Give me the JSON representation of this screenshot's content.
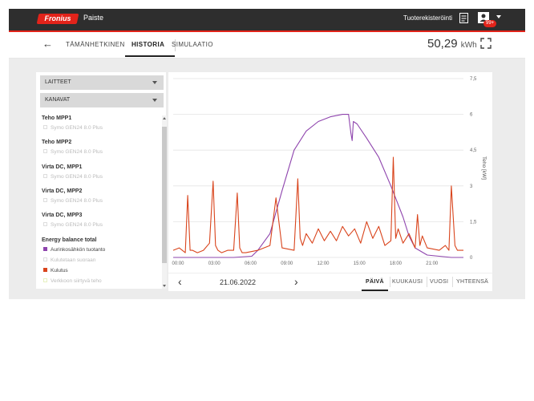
{
  "app": {
    "logo_text": "Fronius",
    "title": "Paiste"
  },
  "header": {
    "register_label": "Tuoterekisteröinti",
    "notification_badge": "99+"
  },
  "nav": {
    "back_icon": "arrow-left-icon",
    "tabs": [
      {
        "label": "TÄMÄNHETKINEN",
        "active": false
      },
      {
        "label": "HISTORIA",
        "active": true
      },
      {
        "label": "SIMULAATIO",
        "active": false
      }
    ],
    "energy_value": "50,29",
    "energy_unit": "kWh"
  },
  "sidebar": {
    "dropdowns": [
      {
        "label": "LAITTEET"
      },
      {
        "label": "KANAVAT"
      }
    ],
    "groups": [
      {
        "title": "Teho MPP1",
        "items": [
          {
            "label": "Symo GEN24 8.0 Plus",
            "color": "#dddddd",
            "active": false
          }
        ]
      },
      {
        "title": "Teho MPP2",
        "items": [
          {
            "label": "Symo GEN24 8.0 Plus",
            "color": "#dddddd",
            "active": false
          }
        ]
      },
      {
        "title": "Virta DC, MPP1",
        "items": [
          {
            "label": "Symo GEN24 8.0 Plus",
            "color": "#dddddd",
            "active": false
          }
        ]
      },
      {
        "title": "Virta DC, MPP2",
        "items": [
          {
            "label": "Symo GEN24 8.0 Plus",
            "color": "#dddddd",
            "active": false
          }
        ]
      },
      {
        "title": "Virta DC, MPP3",
        "items": [
          {
            "label": "Symo GEN24 8.0 Plus",
            "color": "#dddddd",
            "active": false
          }
        ]
      },
      {
        "title": "Energy balance total",
        "items": [
          {
            "label": "Aurinkosähkön tuotanto",
            "color": "#8e44ad",
            "active": true
          },
          {
            "label": "Kulutetaan suoraan",
            "color": "#dddddd",
            "active": false
          },
          {
            "label": "Kulutus",
            "color": "#d9441c",
            "active": true
          },
          {
            "label": "Verkkoon siirtyvä teho",
            "color": "#dddddd",
            "active": false
          }
        ]
      }
    ]
  },
  "chart_data": {
    "type": "line",
    "ylabel": "Teho [kW]",
    "ylim": [
      0,
      7.5
    ],
    "y_ticks": [
      "0",
      "1,5",
      "3",
      "4,5",
      "6",
      "7,5"
    ],
    "x_ticks": [
      "00:00",
      "03:00",
      "06:00",
      "09:00",
      "12:00",
      "15:00",
      "18:00",
      "21:00"
    ],
    "xlim_hours": [
      0,
      24
    ],
    "grid": true,
    "series": [
      {
        "name": "Aurinkosähkön tuotanto",
        "color": "#8e44ad",
        "x": [
          0,
          5,
          6.5,
          7,
          8,
          9,
          10,
          11,
          12,
          13,
          14,
          14.5,
          14.7,
          14.8,
          14.9,
          15.2,
          16,
          17,
          18,
          19,
          19.5,
          20,
          21,
          22,
          23,
          24
        ],
        "y": [
          0,
          0,
          0.05,
          0.3,
          1.0,
          2.8,
          4.5,
          5.3,
          5.7,
          5.9,
          6.0,
          6.0,
          5.2,
          4.9,
          5.7,
          5.6,
          5.0,
          4.2,
          3.0,
          1.7,
          0.9,
          0.4,
          0.1,
          0.05,
          0,
          0
        ]
      },
      {
        "name": "Kulutus",
        "color": "#d9441c",
        "x": [
          0,
          0.5,
          1,
          1.2,
          1.4,
          1.6,
          2,
          2.5,
          3,
          3.3,
          3.5,
          3.7,
          4,
          4.5,
          5,
          5.3,
          5.5,
          5.7,
          6,
          7,
          8,
          8.5,
          9,
          10,
          10.3,
          10.5,
          10.7,
          11,
          11.5,
          12,
          12.5,
          13,
          13.5,
          14,
          14.5,
          15,
          15.5,
          16,
          16.5,
          17,
          17.5,
          18,
          18.2,
          18.4,
          18.6,
          19,
          19.5,
          20,
          20.2,
          20.4,
          20.6,
          21,
          22,
          22.5,
          22.8,
          23,
          23.3,
          23.5,
          24
        ],
        "y": [
          0.3,
          0.4,
          0.2,
          2.6,
          0.3,
          0.3,
          0.2,
          0.3,
          0.6,
          3.2,
          0.5,
          0.3,
          0.2,
          0.3,
          0.3,
          2.7,
          0.4,
          0.2,
          0.2,
          0.3,
          0.5,
          2.5,
          0.4,
          0.3,
          3.3,
          0.8,
          0.5,
          1.0,
          0.6,
          1.2,
          0.7,
          1.1,
          0.7,
          1.3,
          0.9,
          1.2,
          0.6,
          1.5,
          0.8,
          1.3,
          0.5,
          0.7,
          4.2,
          0.8,
          1.2,
          0.6,
          1.0,
          0.4,
          1.8,
          0.5,
          0.9,
          0.4,
          0.3,
          0.5,
          0.3,
          3.0,
          0.5,
          0.3,
          0.3
        ]
      }
    ]
  },
  "footer": {
    "date": "21.06.2022",
    "periods": [
      {
        "label": "PÄIVÄ",
        "active": true
      },
      {
        "label": "KUUKAUSI",
        "active": false
      },
      {
        "label": "VUOSI",
        "active": false
      },
      {
        "label": "YHTEENSÄ",
        "active": false
      }
    ]
  }
}
